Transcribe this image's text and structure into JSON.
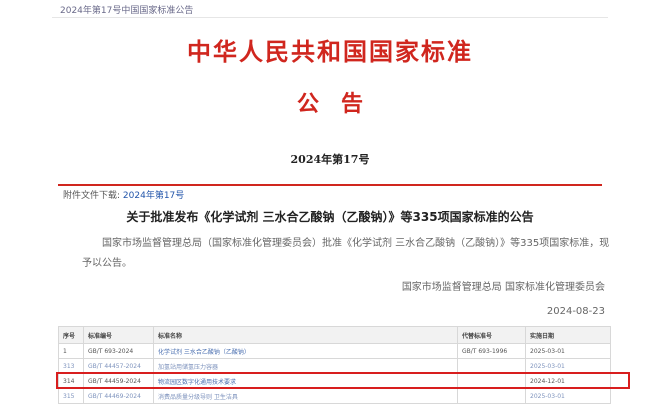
{
  "breadcrumb": "2024年第17号中国国家标准公告",
  "header": {
    "title": "中华人民共和国国家标准",
    "subtitle": "公告",
    "issue": "2024年第17号"
  },
  "attachment": {
    "label": "附件文件下载:",
    "link": "2024年第17号"
  },
  "notice": {
    "title": "关于批准发布《化学试剂 三水合乙酸钠（乙酸钠）》等335项国家标准的公告",
    "body": "国家市场监督管理总局（国家标准化管理委员会）批准《化学试剂 三水合乙酸钠（乙酸钠）》等335项国家标准，现予以公告。",
    "issuer": "国家市场监督管理总局 国家标准化管理委员会",
    "date": "2024-08-23"
  },
  "table": {
    "headers": [
      "序号",
      "标准编号",
      "标准名称",
      "代替标准号",
      "实施日期"
    ],
    "rows": [
      {
        "no": "1",
        "code": "GB/T 693-2024",
        "name": "化学试剂 三水合乙酸钠（乙酸钠）",
        "replaces": "GB/T 693-1996",
        "date": "2025-03-01"
      },
      {
        "no": "313",
        "code": "GB/T 44457-2024",
        "name": "加氢站用储氢压力容器",
        "replaces": "",
        "date": "2025-03-01"
      },
      {
        "no": "314",
        "code": "GB/T 44459-2024",
        "name": "物流园区数字化通用技术要求",
        "replaces": "",
        "date": "2024-12-01"
      },
      {
        "no": "315",
        "code": "GB/T 44469-2024",
        "name": "消费品质量分级导则 卫生洁具",
        "replaces": "",
        "date": "2025-03-01"
      }
    ]
  },
  "colors": {
    "title_red": "#d0261e",
    "highlight_red": "#d81e1e",
    "link_blue": "#4a6fb0"
  }
}
